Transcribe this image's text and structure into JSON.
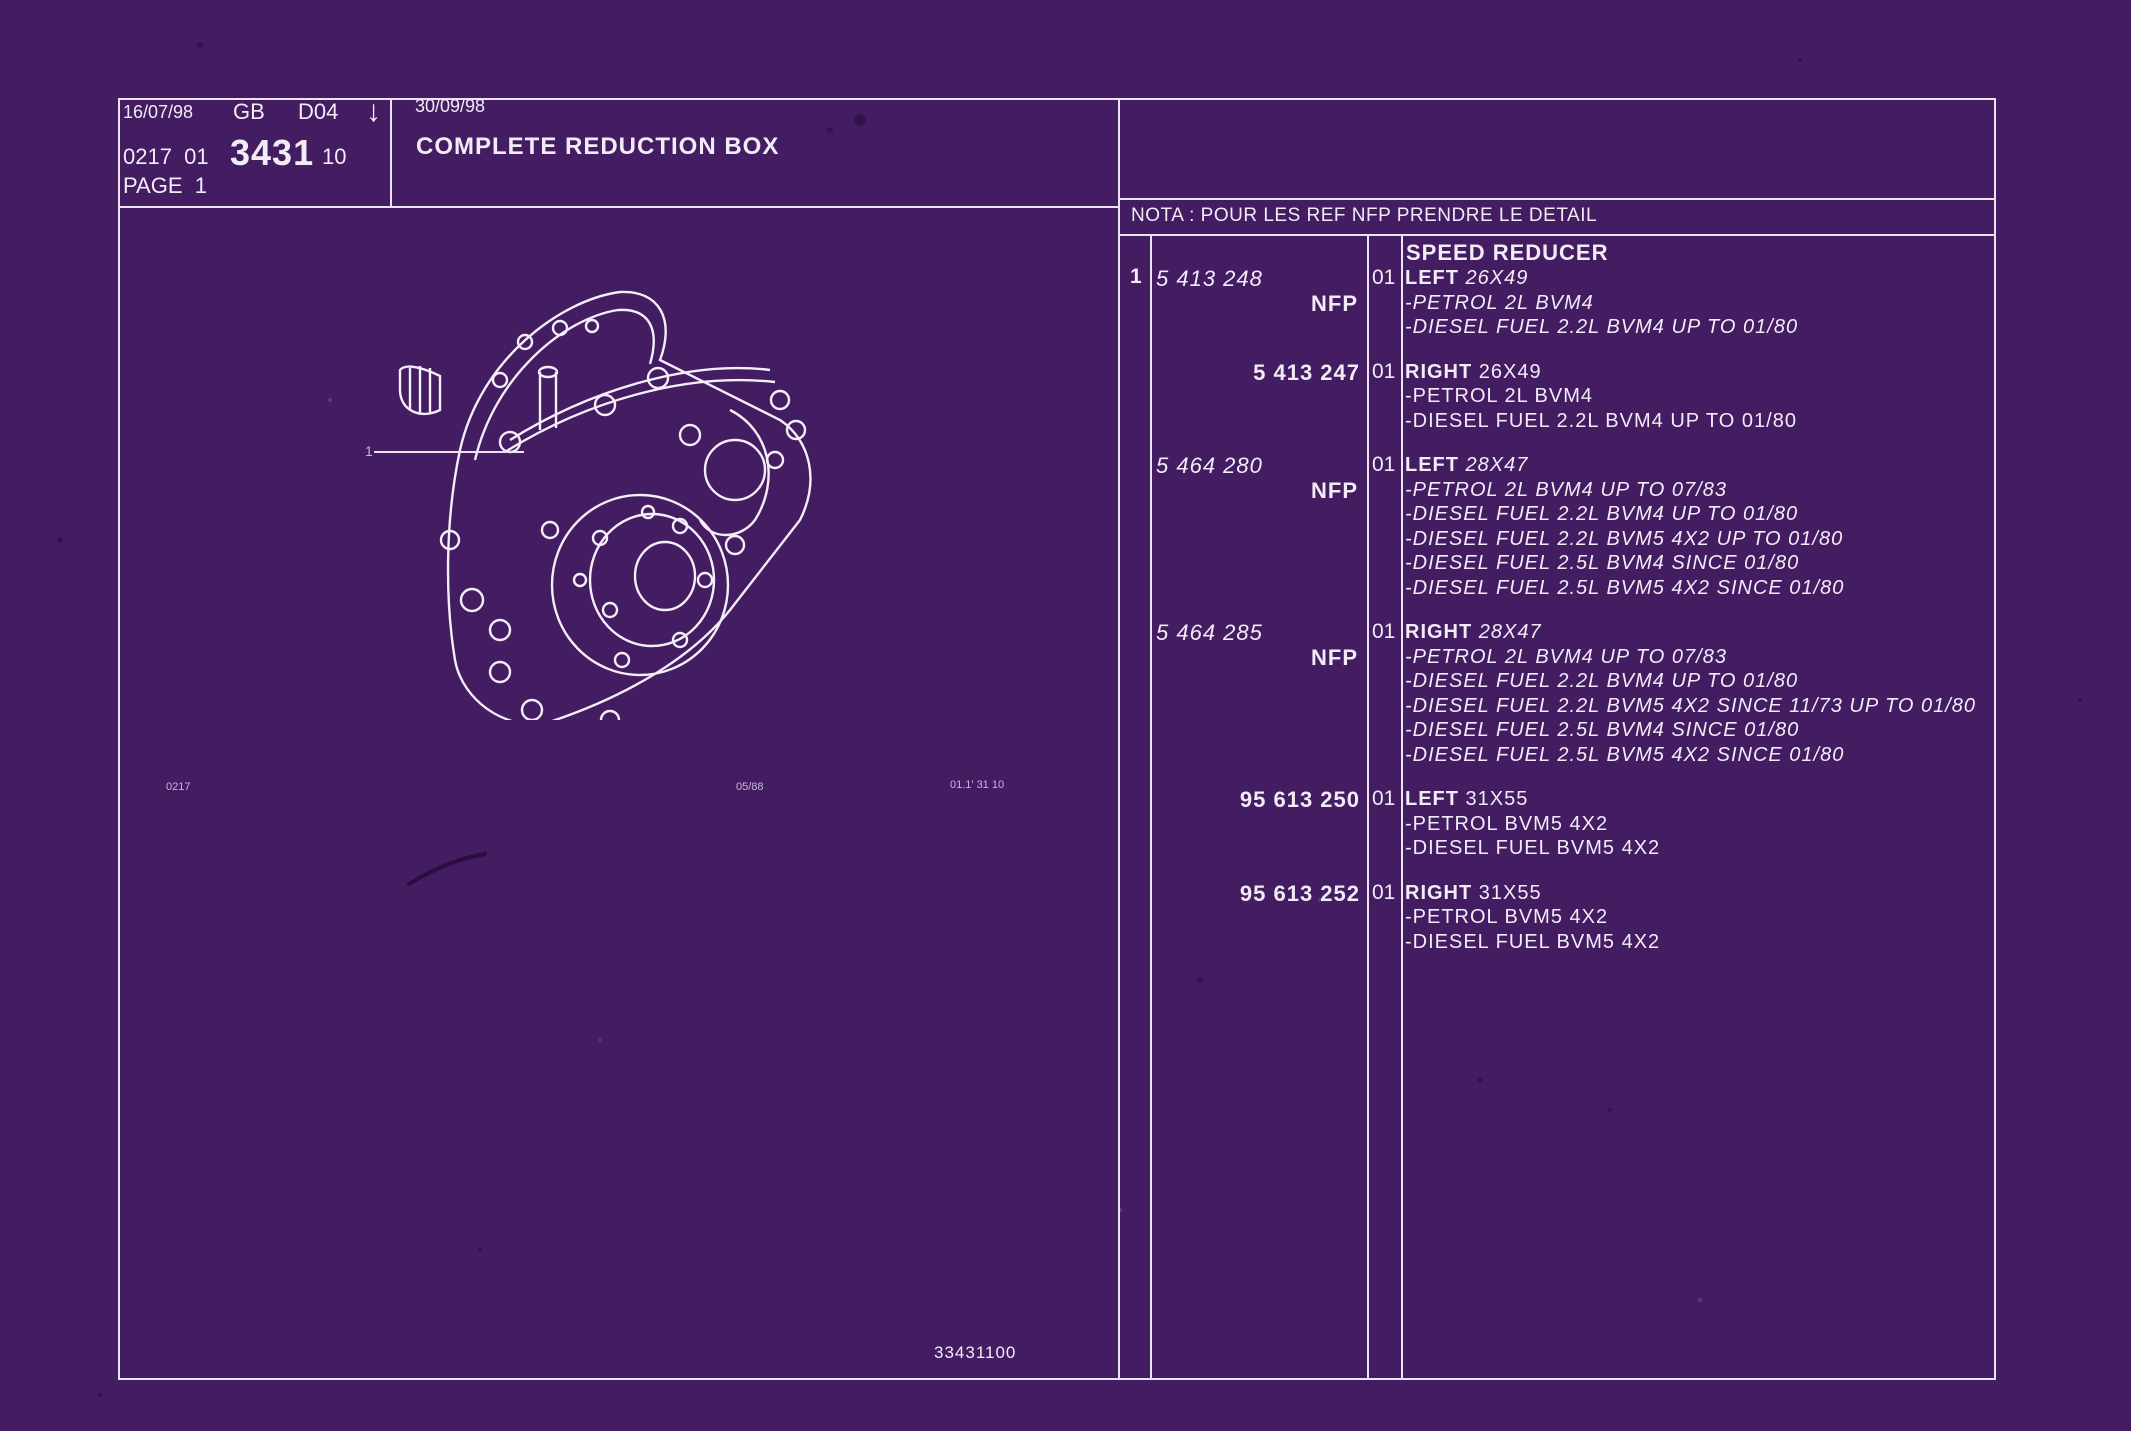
{
  "header": {
    "date1": "16/07/98",
    "lang": "GB",
    "code": "D04",
    "arrow": "↓",
    "date2": "30/09/98",
    "ref_prefix": "0217  01",
    "ref_main": "3431",
    "ref_suffix": "10",
    "page": "PAGE  1",
    "title": "COMPLETE REDUCTION BOX"
  },
  "nota": "NOTA : POUR LES REF NFP PRENDRE LE DETAIL",
  "section_title": "SPEED REDUCER",
  "illustration": {
    "callout": "1",
    "footer_left": "0217",
    "footer_mid": "05/88",
    "footer_right": "01.1' 31 10",
    "drawing_code": "33431100"
  },
  "parts": [
    {
      "index": "1",
      "ref": "5 413 248",
      "ref_style": "italic",
      "nfp": "NFP",
      "qty": "01",
      "head": "LEFT",
      "head_rest": " 26X49",
      "italic": true,
      "lines": [
        "-PETROL 2L BVM4",
        "-DIESEL FUEL 2.2L BVM4 UP TO 01/80"
      ]
    },
    {
      "index": "",
      "ref": "5 413 247",
      "ref_style": "bold",
      "nfp": "",
      "qty": "01",
      "head": "RIGHT",
      "head_rest": " 26X49",
      "italic": false,
      "lines": [
        "-PETROL 2L BVM4",
        "-DIESEL FUEL 2.2L BVM4 UP TO 01/80"
      ]
    },
    {
      "index": "",
      "ref": "5 464 280",
      "ref_style": "italic",
      "nfp": "NFP",
      "qty": "01",
      "head": "LEFT",
      "head_rest": " 28X47",
      "italic": true,
      "lines": [
        "-PETROL 2L BVM4 UP TO 07/83",
        "-DIESEL FUEL 2.2L BVM4 UP TO 01/80",
        "-DIESEL FUEL 2.2L BVM5 4X2 UP TO 01/80",
        "-DIESEL FUEL 2.5L BVM4 SINCE 01/80",
        "-DIESEL FUEL 2.5L BVM5 4X2 SINCE 01/80"
      ]
    },
    {
      "index": "",
      "ref": "5 464 285",
      "ref_style": "italic",
      "nfp": "NFP",
      "qty": "01",
      "head": "RIGHT",
      "head_rest": " 28X47",
      "italic": true,
      "lines": [
        "-PETROL 2L BVM4 UP TO 07/83",
        "-DIESEL FUEL 2.2L BVM4 UP TO 01/80",
        "-DIESEL FUEL 2.2L BVM5 4X2 SINCE 11/73 UP TO 01/80",
        "-DIESEL FUEL 2.5L BVM4 SINCE 01/80",
        "-DIESEL FUEL 2.5L BVM5 4X2 SINCE 01/80"
      ]
    },
    {
      "index": "",
      "ref": "95 613 250",
      "ref_style": "bold",
      "nfp": "",
      "qty": "01",
      "head": "LEFT",
      "head_rest": " 31X55",
      "italic": false,
      "lines": [
        "-PETROL BVM5 4X2",
        "-DIESEL FUEL BVM5 4X2"
      ]
    },
    {
      "index": "",
      "ref": "95 613 252",
      "ref_style": "bold",
      "nfp": "",
      "qty": "01",
      "head": "RIGHT",
      "head_rest": " 31X55",
      "italic": false,
      "lines": [
        "-PETROL BVM5 4X2",
        "-DIESEL FUEL BVM5 4X2"
      ]
    }
  ]
}
